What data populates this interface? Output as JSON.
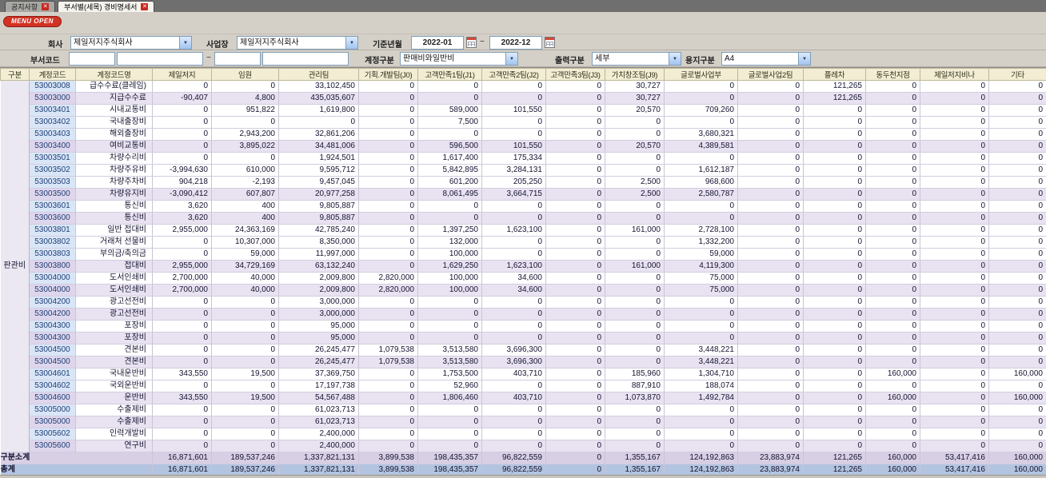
{
  "icons": {
    "close": "✕",
    "arrow": "▼"
  },
  "menu_open_label": "MENU OPEN",
  "tabs": [
    {
      "label": "공지사항",
      "active": false
    },
    {
      "label": "부서별(세목) 경비명세서",
      "active": true
    }
  ],
  "filters": {
    "company_label": "회사",
    "company_value": "제일저지주식회사",
    "site_label": "사업장",
    "site_value": "제일저지주식회사",
    "period_label": "기준년월",
    "period_from": "2022-01",
    "period_to": "2022-12",
    "tilde": "~",
    "dept_label": "부서코드",
    "dept_from": "",
    "dept_from_name": "",
    "dept_to": "",
    "dept_to_name": "",
    "account_label": "계정구분",
    "account_value": "판매비와일반비",
    "output_label": "출력구분",
    "output_value": "세부",
    "paper_label": "용지구분",
    "paper_value": "A4"
  },
  "table": {
    "group_label": "판관비",
    "columns": [
      "구분",
      "계정코드",
      "계정코드명",
      "제일저지",
      "임원",
      "관리팀",
      "기획.개발팀(J0)",
      "고객만족1팀(J1)",
      "고객만족2팀(J2)",
      "고객만족3팀(J3)",
      "가치창조팀(J9)",
      "글로벌사업부",
      "글로벌사업2팀",
      "플레차",
      "동두천지점",
      "제일저지비나",
      "기타"
    ],
    "rows": [
      {
        "code": "53003008",
        "name": "급수수료(클레임)",
        "kind": "detail",
        "values": [
          "0",
          "0",
          "33,102,450",
          "0",
          "0",
          "0",
          "0",
          "30,727",
          "0",
          "0",
          "121,265",
          "0",
          "0",
          "0"
        ]
      },
      {
        "code": "53003000",
        "name": "지급수수료",
        "kind": "subtotal",
        "values": [
          "-90,407",
          "4,800",
          "435,035,607",
          "0",
          "0",
          "0",
          "0",
          "30,727",
          "0",
          "0",
          "121,265",
          "0",
          "0",
          "0"
        ]
      },
      {
        "code": "53003401",
        "name": "시내교통비",
        "kind": "detail",
        "values": [
          "0",
          "951,822",
          "1,619,800",
          "0",
          "589,000",
          "101,550",
          "0",
          "20,570",
          "709,260",
          "0",
          "0",
          "0",
          "0",
          "0"
        ]
      },
      {
        "code": "53003402",
        "name": "국내출장비",
        "kind": "detail",
        "values": [
          "0",
          "0",
          "0",
          "0",
          "7,500",
          "0",
          "0",
          "0",
          "0",
          "0",
          "0",
          "0",
          "0",
          "0"
        ]
      },
      {
        "code": "53003403",
        "name": "해외출장비",
        "kind": "detail",
        "values": [
          "0",
          "2,943,200",
          "32,861,206",
          "0",
          "0",
          "0",
          "0",
          "0",
          "3,680,321",
          "0",
          "0",
          "0",
          "0",
          "0"
        ]
      },
      {
        "code": "53003400",
        "name": "여비교통비",
        "kind": "subtotal",
        "values": [
          "0",
          "3,895,022",
          "34,481,006",
          "0",
          "596,500",
          "101,550",
          "0",
          "20,570",
          "4,389,581",
          "0",
          "0",
          "0",
          "0",
          "0"
        ]
      },
      {
        "code": "53003501",
        "name": "차량수리비",
        "kind": "detail",
        "values": [
          "0",
          "0",
          "1,924,501",
          "0",
          "1,617,400",
          "175,334",
          "0",
          "0",
          "0",
          "0",
          "0",
          "0",
          "0",
          "0"
        ]
      },
      {
        "code": "53003502",
        "name": "차량주유비",
        "kind": "detail",
        "values": [
          "-3,994,630",
          "610,000",
          "9,595,712",
          "0",
          "5,842,895",
          "3,284,131",
          "0",
          "0",
          "1,612,187",
          "0",
          "0",
          "0",
          "0",
          "0"
        ]
      },
      {
        "code": "53003503",
        "name": "차량주차비",
        "kind": "detail",
        "values": [
          "904,218",
          "-2,193",
          "9,457,045",
          "0",
          "601,200",
          "205,250",
          "0",
          "2,500",
          "968,600",
          "0",
          "0",
          "0",
          "0",
          "0"
        ]
      },
      {
        "code": "53003500",
        "name": "차량유지비",
        "kind": "subtotal",
        "values": [
          "-3,090,412",
          "607,807",
          "20,977,258",
          "0",
          "8,061,495",
          "3,664,715",
          "0",
          "2,500",
          "2,580,787",
          "0",
          "0",
          "0",
          "0",
          "0"
        ]
      },
      {
        "code": "53003601",
        "name": "통신비",
        "kind": "detail",
        "values": [
          "3,620",
          "400",
          "9,805,887",
          "0",
          "0",
          "0",
          "0",
          "0",
          "0",
          "0",
          "0",
          "0",
          "0",
          "0"
        ]
      },
      {
        "code": "53003600",
        "name": "통신비",
        "kind": "subtotal",
        "values": [
          "3,620",
          "400",
          "9,805,887",
          "0",
          "0",
          "0",
          "0",
          "0",
          "0",
          "0",
          "0",
          "0",
          "0",
          "0"
        ]
      },
      {
        "code": "53003801",
        "name": "일반 접대비",
        "kind": "detail",
        "values": [
          "2,955,000",
          "24,363,169",
          "42,785,240",
          "0",
          "1,397,250",
          "1,623,100",
          "0",
          "161,000",
          "2,728,100",
          "0",
          "0",
          "0",
          "0",
          "0"
        ]
      },
      {
        "code": "53003802",
        "name": "거래처 선물비",
        "kind": "detail",
        "values": [
          "0",
          "10,307,000",
          "8,350,000",
          "0",
          "132,000",
          "0",
          "0",
          "0",
          "1,332,200",
          "0",
          "0",
          "0",
          "0",
          "0"
        ]
      },
      {
        "code": "53003803",
        "name": "부의금/축의금",
        "kind": "detail",
        "values": [
          "0",
          "59,000",
          "11,997,000",
          "0",
          "100,000",
          "0",
          "0",
          "0",
          "59,000",
          "0",
          "0",
          "0",
          "0",
          "0"
        ]
      },
      {
        "code": "53003800",
        "name": "접대비",
        "kind": "subtotal",
        "values": [
          "2,955,000",
          "34,729,169",
          "63,132,240",
          "0",
          "1,629,250",
          "1,623,100",
          "0",
          "161,000",
          "4,119,300",
          "0",
          "0",
          "0",
          "0",
          "0"
        ]
      },
      {
        "code": "53004000",
        "name": "도서인쇄비",
        "kind": "detail",
        "values": [
          "2,700,000",
          "40,000",
          "2,009,800",
          "2,820,000",
          "100,000",
          "34,600",
          "0",
          "0",
          "75,000",
          "0",
          "0",
          "0",
          "0",
          "0"
        ]
      },
      {
        "code": "53004000",
        "name": "도서인쇄비",
        "kind": "subtotal",
        "values": [
          "2,700,000",
          "40,000",
          "2,009,800",
          "2,820,000",
          "100,000",
          "34,600",
          "0",
          "0",
          "75,000",
          "0",
          "0",
          "0",
          "0",
          "0"
        ]
      },
      {
        "code": "53004200",
        "name": "광고선전비",
        "kind": "detail",
        "values": [
          "0",
          "0",
          "3,000,000",
          "0",
          "0",
          "0",
          "0",
          "0",
          "0",
          "0",
          "0",
          "0",
          "0",
          "0"
        ]
      },
      {
        "code": "53004200",
        "name": "광고선전비",
        "kind": "subtotal",
        "values": [
          "0",
          "0",
          "3,000,000",
          "0",
          "0",
          "0",
          "0",
          "0",
          "0",
          "0",
          "0",
          "0",
          "0",
          "0"
        ]
      },
      {
        "code": "53004300",
        "name": "포장비",
        "kind": "detail",
        "values": [
          "0",
          "0",
          "95,000",
          "0",
          "0",
          "0",
          "0",
          "0",
          "0",
          "0",
          "0",
          "0",
          "0",
          "0"
        ]
      },
      {
        "code": "53004300",
        "name": "포장비",
        "kind": "subtotal",
        "values": [
          "0",
          "0",
          "95,000",
          "0",
          "0",
          "0",
          "0",
          "0",
          "0",
          "0",
          "0",
          "0",
          "0",
          "0"
        ]
      },
      {
        "code": "53004500",
        "name": "견본비",
        "kind": "detail",
        "values": [
          "0",
          "0",
          "26,245,477",
          "1,079,538",
          "3,513,580",
          "3,696,300",
          "0",
          "0",
          "3,448,221",
          "0",
          "0",
          "0",
          "0",
          "0"
        ]
      },
      {
        "code": "53004500",
        "name": "견본비",
        "kind": "subtotal",
        "values": [
          "0",
          "0",
          "26,245,477",
          "1,079,538",
          "3,513,580",
          "3,696,300",
          "0",
          "0",
          "3,448,221",
          "0",
          "0",
          "0",
          "0",
          "0"
        ]
      },
      {
        "code": "53004601",
        "name": "국내운반비",
        "kind": "detail",
        "values": [
          "343,550",
          "19,500",
          "37,369,750",
          "0",
          "1,753,500",
          "403,710",
          "0",
          "185,960",
          "1,304,710",
          "0",
          "0",
          "160,000",
          "0",
          "160,000"
        ]
      },
      {
        "code": "53004602",
        "name": "국외운반비",
        "kind": "detail",
        "values": [
          "0",
          "0",
          "17,197,738",
          "0",
          "52,960",
          "0",
          "0",
          "887,910",
          "188,074",
          "0",
          "0",
          "0",
          "0",
          "0"
        ]
      },
      {
        "code": "53004600",
        "name": "운반비",
        "kind": "subtotal",
        "values": [
          "343,550",
          "19,500",
          "54,567,488",
          "0",
          "1,806,460",
          "403,710",
          "0",
          "1,073,870",
          "1,492,784",
          "0",
          "0",
          "160,000",
          "0",
          "160,000"
        ]
      },
      {
        "code": "53005000",
        "name": "수출제비",
        "kind": "detail",
        "values": [
          "0",
          "0",
          "61,023,713",
          "0",
          "0",
          "0",
          "0",
          "0",
          "0",
          "0",
          "0",
          "0",
          "0",
          "0"
        ]
      },
      {
        "code": "53005000",
        "name": "수출제비",
        "kind": "subtotal",
        "values": [
          "0",
          "0",
          "61,023,713",
          "0",
          "0",
          "0",
          "0",
          "0",
          "0",
          "0",
          "0",
          "0",
          "0",
          "0"
        ]
      },
      {
        "code": "53005602",
        "name": "인력개발비",
        "kind": "detail",
        "values": [
          "0",
          "0",
          "2,400,000",
          "0",
          "0",
          "0",
          "0",
          "0",
          "0",
          "0",
          "0",
          "0",
          "0",
          "0"
        ]
      },
      {
        "code": "53005600",
        "name": "연구비",
        "kind": "subtotal",
        "values": [
          "0",
          "0",
          "2,400,000",
          "0",
          "0",
          "0",
          "0",
          "0",
          "0",
          "0",
          "0",
          "0",
          "0",
          "0"
        ]
      }
    ],
    "subtotal_row": {
      "label": "구분소계",
      "values": [
        "16,871,601",
        "189,537,246",
        "1,337,821,131",
        "3,899,538",
        "198,435,357",
        "96,822,559",
        "0",
        "1,355,167",
        "124,192,863",
        "23,883,974",
        "121,265",
        "160,000",
        "53,417,416",
        "160,000"
      ]
    },
    "total_row": {
      "label": "총계",
      "values": [
        "16,871,601",
        "189,537,246",
        "1,337,821,131",
        "3,899,538",
        "198,435,357",
        "96,822,559",
        "0",
        "1,355,167",
        "124,192,863",
        "23,883,974",
        "121,265",
        "160,000",
        "53,417,416",
        "160,000"
      ]
    }
  }
}
